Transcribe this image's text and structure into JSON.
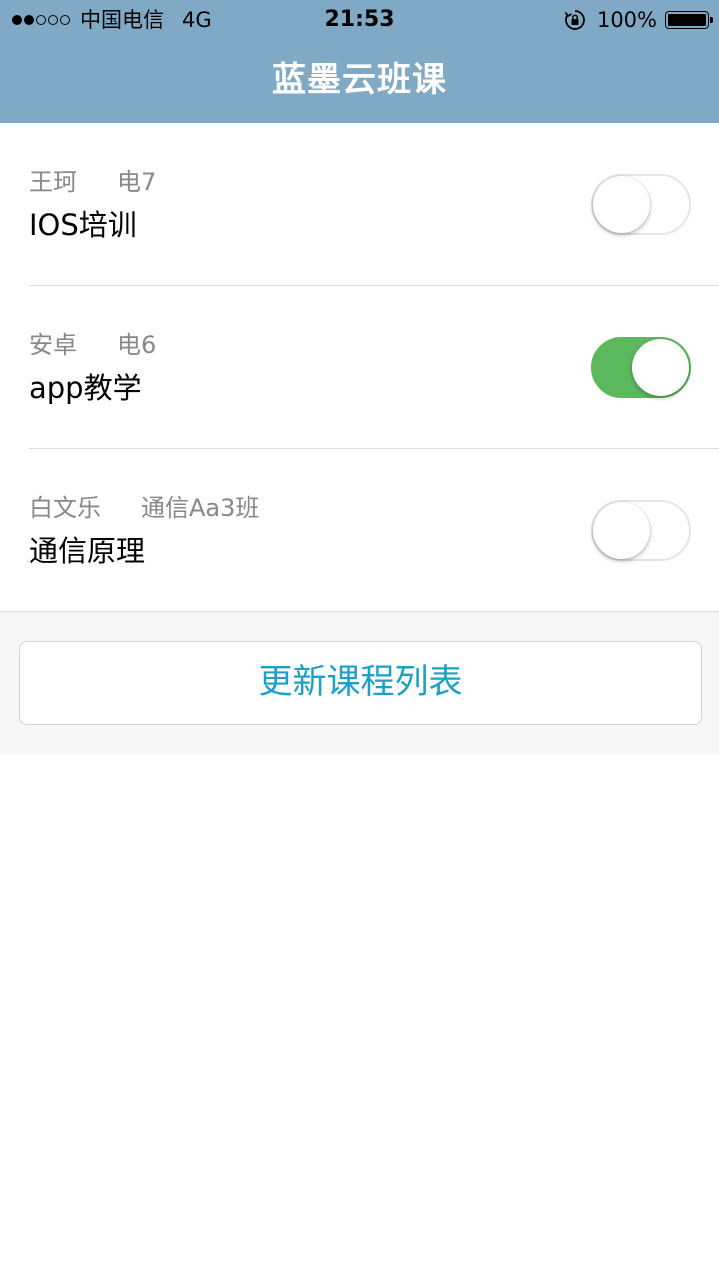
{
  "status_bar": {
    "signal_filled": 2,
    "signal_total": 5,
    "carrier": "中国电信",
    "network": "4G",
    "time": "21:53",
    "battery": "100%",
    "battery_level": 1.0
  },
  "nav": {
    "title": "蓝墨云班课"
  },
  "courses": [
    {
      "teacher": "王珂",
      "class": "电7",
      "name": "IOS培训",
      "enabled": false
    },
    {
      "teacher": "安卓",
      "class": "电6",
      "name": "app教学",
      "enabled": true
    },
    {
      "teacher": "白文乐",
      "class": "通信Aa3班",
      "name": "通信原理",
      "enabled": false
    }
  ],
  "actions": {
    "refresh_label": "更新课程列表"
  },
  "colors": {
    "nav_background": "#80a9c6",
    "toggle_on": "#5cb85c",
    "button_text": "#1ba0c8"
  }
}
